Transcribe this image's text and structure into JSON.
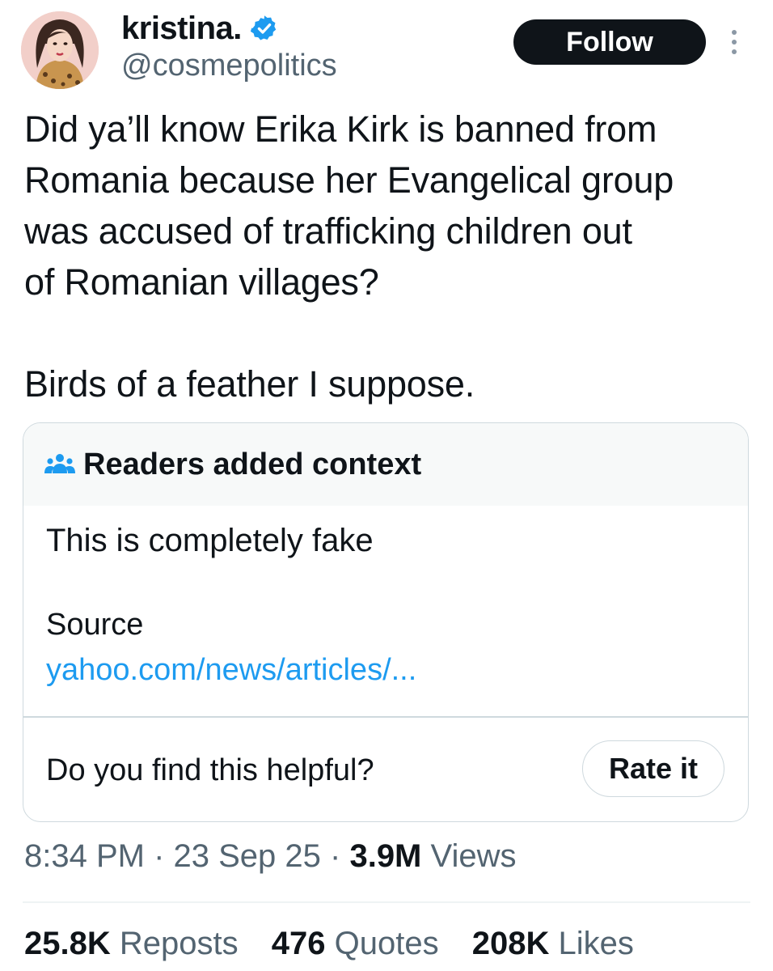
{
  "author": {
    "display_name": "kristina.",
    "handle": "@cosmepolitics",
    "verified": true,
    "avatar_icon": "profile-avatar-illustration"
  },
  "follow_label": "Follow",
  "more_icon": "more-vertical-icon",
  "tweet": {
    "lines": [
      "Did ya’ll know Erika Kirk is banned from",
      "Romania because her Evangelical group",
      "was accused of trafficking children out",
      "of Romanian villages?"
    ],
    "second_paragraph": "Birds of a feather I suppose."
  },
  "community_note": {
    "icon": "community-notes-people-icon",
    "title": "Readers added context",
    "body": "This is completely fake",
    "source_label": "Source",
    "source_link": "yahoo.com/news/articles/...",
    "helpful_question": "Do you find this helpful?",
    "rate_label": "Rate it"
  },
  "meta": {
    "time": "8:34 PM",
    "sep1": " · ",
    "date": "23 Sep 25",
    "sep2": " · ",
    "views_count": "3.9M",
    "views_label": " Views"
  },
  "stats": {
    "reposts_count": "25.8K",
    "reposts_label": "Reposts",
    "quotes_count": "476",
    "quotes_label": "Quotes",
    "likes_count": "208K",
    "likes_label": "Likes"
  },
  "colors": {
    "text": "#0f1419",
    "secondary": "#536471",
    "link": "#1d9bf0",
    "border": "#cfd9de",
    "note_header_bg": "#f7f9f9"
  }
}
